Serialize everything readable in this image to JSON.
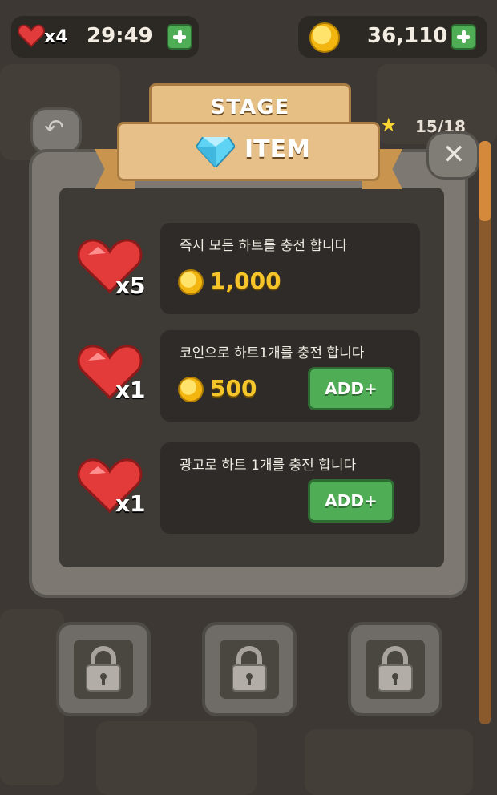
{
  "hud": {
    "lives": "x4",
    "timer": "29:49",
    "coins": "36,110"
  },
  "nav": {
    "stars": "15/18"
  },
  "banners": {
    "stage": "STAGE",
    "item": "ITEM"
  },
  "shop": [
    {
      "desc": "즉시 모든 하트를 충전 합니다",
      "multiplier": "x5",
      "price": "1,000",
      "button": ""
    },
    {
      "desc": "코인으로 하트1개를 충전 합니다",
      "multiplier": "x1",
      "price": "500",
      "button": "ADD+"
    },
    {
      "desc": "광고로 하트 1개를 충전 합니다",
      "multiplier": "x1",
      "price": "",
      "button": "ADD+"
    }
  ],
  "colors": {
    "background": "#3d3833",
    "accent_green": "#4fae55",
    "coin_gold": "#f6c52b",
    "banner_wood": "#e7c089"
  },
  "icons": [
    "heart-icon",
    "coin-icon",
    "plus-icon",
    "back-arrow-icon",
    "star-icon",
    "close-icon",
    "diamond-icon",
    "lock-icon"
  ]
}
